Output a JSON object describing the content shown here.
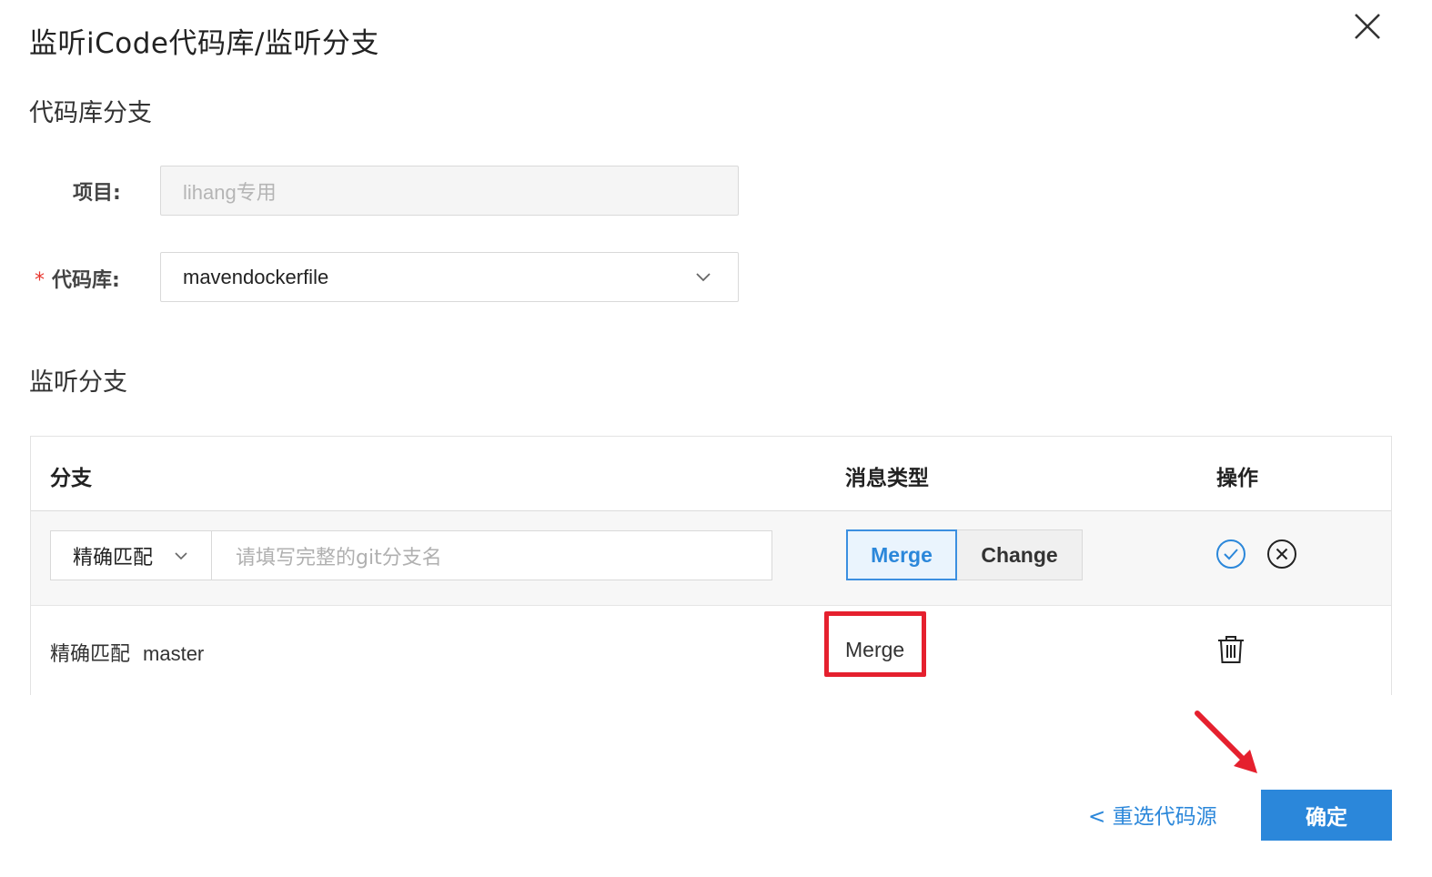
{
  "dialog": {
    "title": "监听iCode代码库/监听分支",
    "close_icon": "close-icon"
  },
  "repo_section": {
    "title": "代码库分支",
    "project_label": "项目:",
    "project_value": "lihang专用",
    "repo_required_mark": "*",
    "repo_label": "代码库:",
    "repo_value": "mavendockerfile"
  },
  "branch_section": {
    "title": "监听分支",
    "columns": {
      "branch": "分支",
      "message_type": "消息类型",
      "action": "操作"
    },
    "edit_row": {
      "match_mode": "精确匹配",
      "branch_placeholder": "请填写完整的git分支名",
      "type_options": [
        "Merge",
        "Change"
      ],
      "selected_type": "Merge"
    },
    "rows": [
      {
        "match_mode": "精确匹配",
        "branch": "master",
        "message_type": "Merge"
      }
    ]
  },
  "footer": {
    "back_label": "< 重选代码源",
    "confirm_label": "确定"
  },
  "colors": {
    "primary": "#2b87da",
    "annotation_red": "#e5202e",
    "required_red": "#e8372f"
  }
}
